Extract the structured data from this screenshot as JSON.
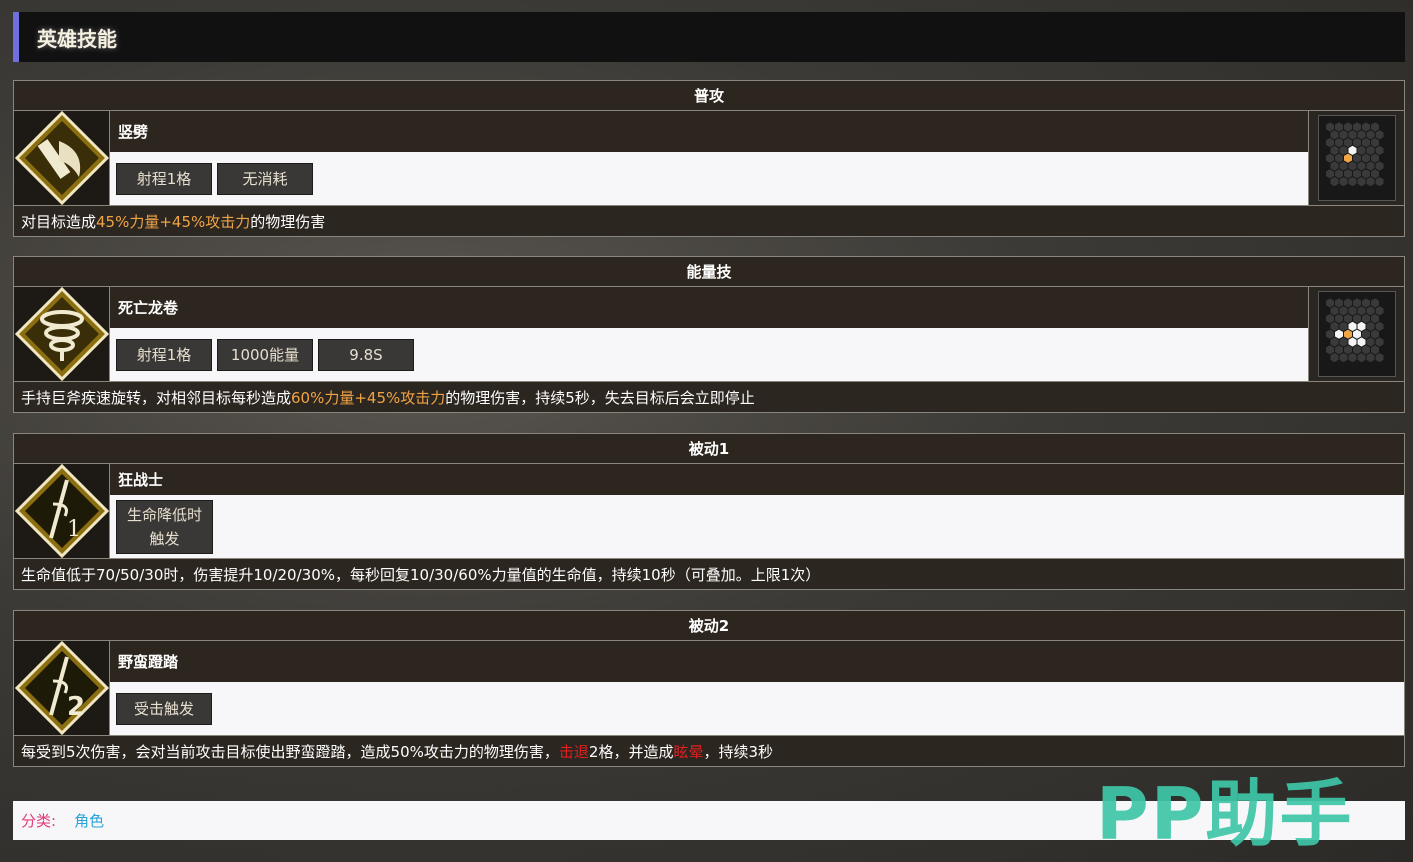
{
  "header": {
    "title": "英雄技能"
  },
  "skills": [
    {
      "category": "普攻",
      "name": "竖劈",
      "icon": "axe-strike-icon",
      "tags": [
        "射程1格",
        "无消耗"
      ],
      "desc_pre": "对目标造成",
      "desc_hl": "45%力量+45%攻击力",
      "desc_post": "的物理伤害",
      "range_icon": "hex-range-1-icon"
    },
    {
      "category": "能量技",
      "name": "死亡龙卷",
      "icon": "whirlwind-icon",
      "tags": [
        "射程1格",
        "1000能量",
        "9.8S"
      ],
      "desc_pre": "手持巨斧疾速旋转，对相邻目标每秒造成",
      "desc_hl": "60%力量+45%攻击力",
      "desc_post": "的物理伤害，持续5秒，失去目标后会立即停止",
      "range_icon": "hex-range-adjacent-icon"
    },
    {
      "category": "被动1",
      "name": "狂战士",
      "icon": "passive-1-icon",
      "tags": [
        "生命降低时",
        "触发"
      ],
      "desc": "生命值低于70/50/30时，伤害提升10/20/30%，每秒回复10/30/60%力量值的生命值，持续10秒（可叠加。上限1次）"
    },
    {
      "category": "被动2",
      "name": "野蛮蹬踏",
      "icon": "passive-2-icon",
      "tags": [
        "受击触发"
      ],
      "desc_pre": "每受到5次伤害，会对当前攻击目标使出野蛮蹬踏，造成50%攻击力的物理伤害，",
      "desc_hl1": "击退",
      "desc_mid": "2格，并造成",
      "desc_hl2": "眩晕",
      "desc_post": "，持续3秒"
    }
  ],
  "footer": {
    "category_label": "分类:",
    "category_value": "角色"
  },
  "watermark": "PP助手",
  "colors": {
    "accent": "#6f6fe0",
    "highlight": "#f1a445",
    "red": "#e01f1f",
    "footer_label": "#e23a7a",
    "footer_link": "#2aa3d8"
  }
}
